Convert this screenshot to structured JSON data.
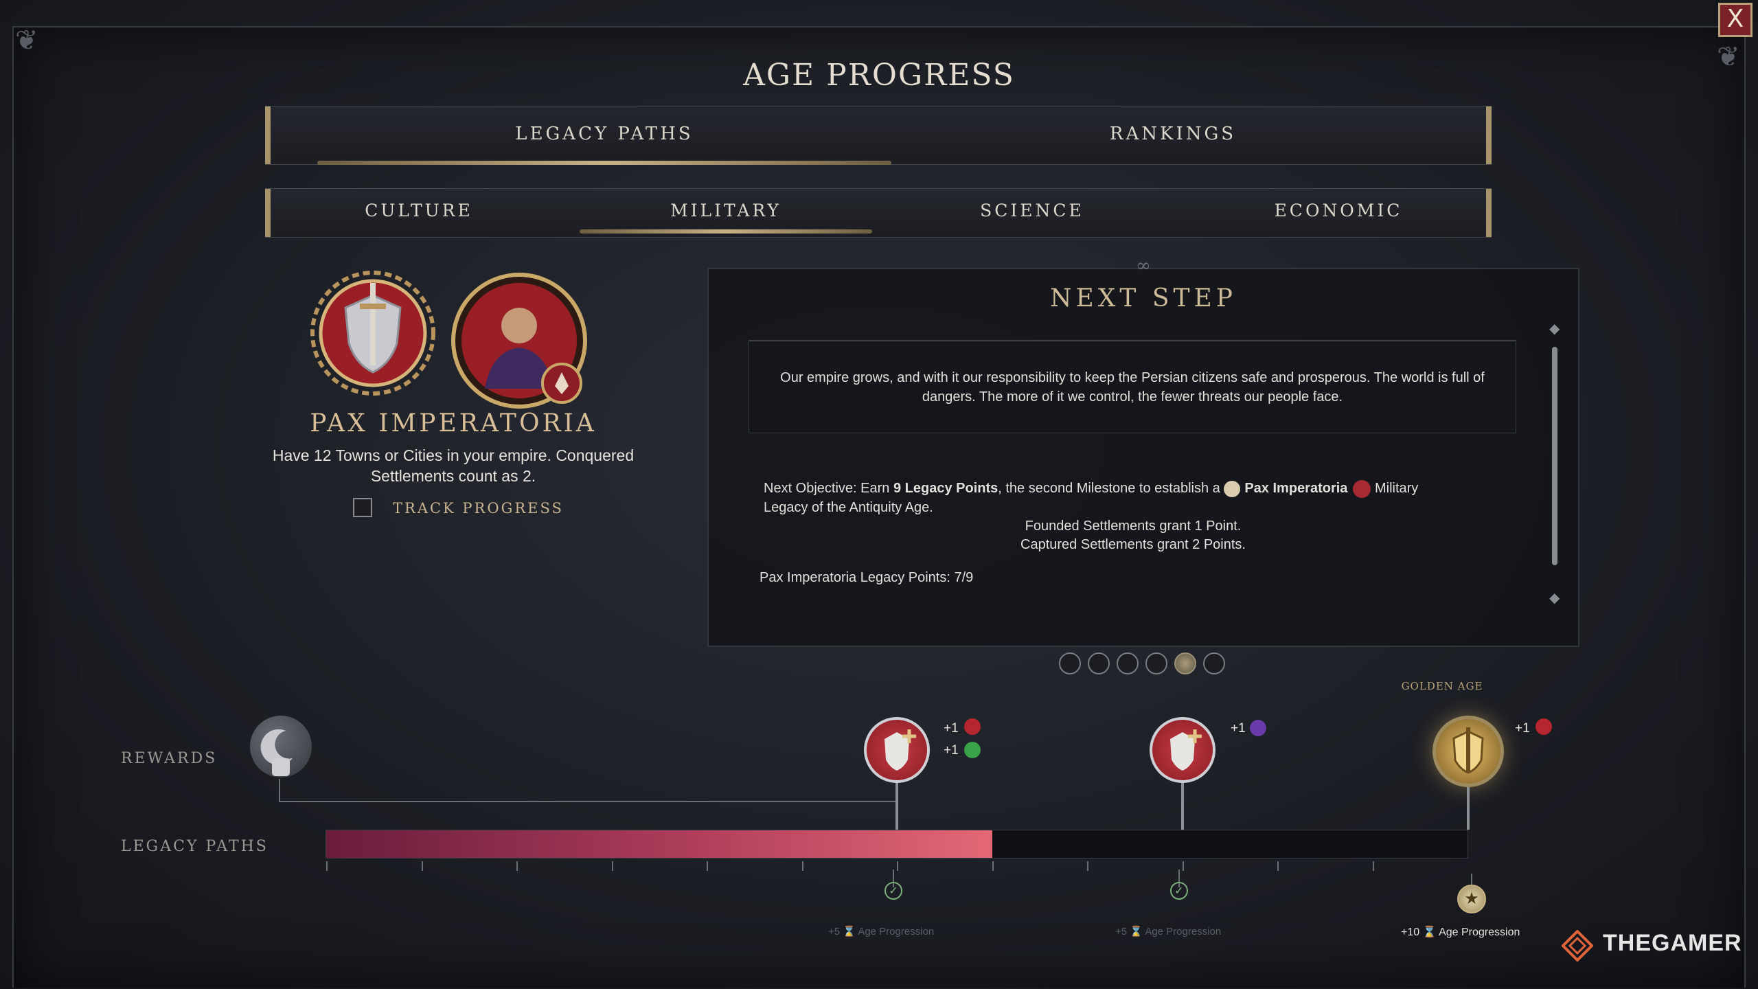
{
  "window": {
    "title": "AGE PROGRESS",
    "close_label": "X"
  },
  "main_tabs": [
    {
      "label": "LEGACY PATHS",
      "selected": true
    },
    {
      "label": "RANKINGS",
      "selected": false
    }
  ],
  "path_tabs": [
    {
      "label": "CULTURE",
      "selected": false
    },
    {
      "label": "MILITARY",
      "selected": true
    },
    {
      "label": "SCIENCE",
      "selected": false
    },
    {
      "label": "ECONOMIC",
      "selected": false
    }
  ],
  "legacy": {
    "name": "PAX IMPERATORIA",
    "description": "Have 12 Towns or Cities in your empire. Conquered Settlements count as 2.",
    "track_label": "TRACK PROGRESS",
    "track_checked": false,
    "icons": [
      "shield-sword-laurel-icon",
      "leader-portrait-icon"
    ]
  },
  "next_step": {
    "title": "NEXT STEP",
    "quote": "Our empire grows, and with it our responsibility to keep the Persian citizens safe and prosperous. The world is full of dangers. The more of it we control, the fewer threats our people face.",
    "objective_prefix": "Next Objective: Earn ",
    "objective_points": "9 Legacy Points",
    "objective_mid": ", the second Milestone to establish a ",
    "objective_legacy": "Pax Imperatoria",
    "objective_suffix": " Military",
    "objective_line2": "Legacy of the Antiquity Age.",
    "rule1": "Founded Settlements grant 1 Point.",
    "rule2": "Captured Settlements grant 2 Points.",
    "points_line": "Pax Imperatoria Legacy Points: 7/9"
  },
  "pager": {
    "count": 6,
    "active_index": 4
  },
  "rewards_label": "REWARDS",
  "legacy_paths_label": "LEGACY PATHS",
  "progress": {
    "current": 7,
    "max": 12
  },
  "milestones": [
    {
      "bonuses": [
        "+1",
        "+1"
      ],
      "age_points": "+5",
      "age_label": "Age Progression",
      "completed": true
    },
    {
      "bonuses": [
        "+1"
      ],
      "age_points": "+5",
      "age_label": "Age Progression",
      "completed": true
    },
    {
      "bonuses": [
        "+1"
      ],
      "age_points": "+10",
      "age_label": "Age Progression",
      "completed": false,
      "tag": "GOLDEN AGE"
    }
  ],
  "watermark": "THEGAMER",
  "colors": {
    "accent_gold": "#c7b187",
    "progress_fill": "#e46876",
    "close_red": "#7a2228"
  }
}
